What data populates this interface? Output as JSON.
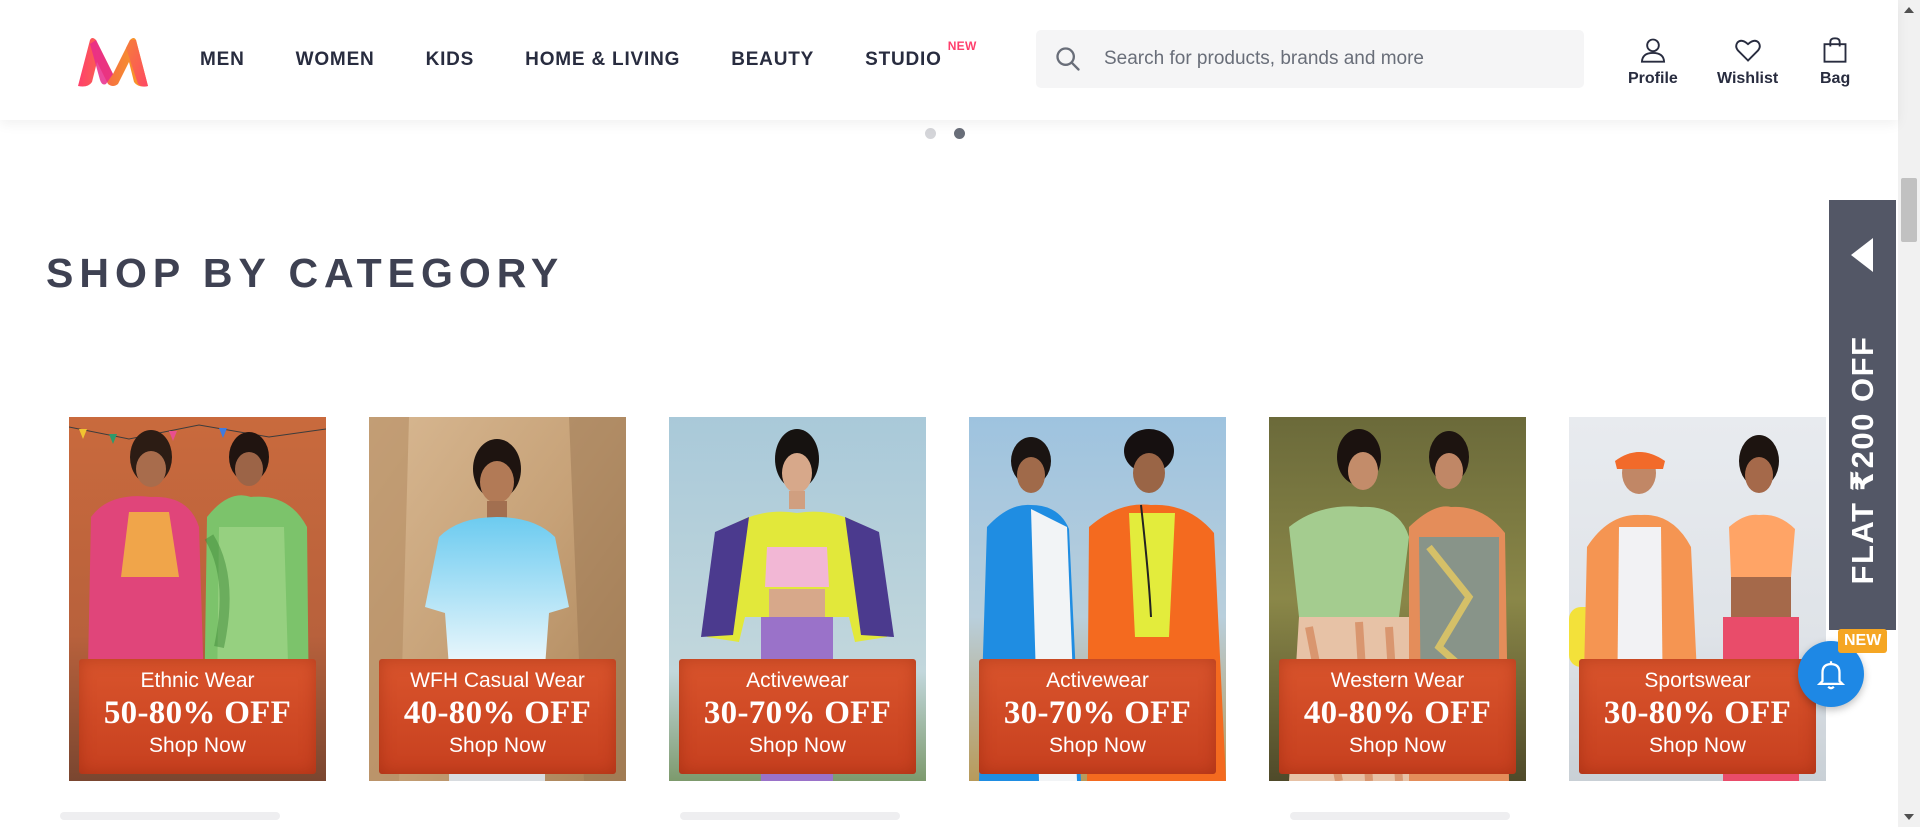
{
  "header": {
    "nav": [
      {
        "label": "MEN"
      },
      {
        "label": "WOMEN"
      },
      {
        "label": "KIDS"
      },
      {
        "label": "HOME & LIVING"
      },
      {
        "label": "BEAUTY"
      },
      {
        "label": "STUDIO",
        "tag": "NEW"
      }
    ],
    "search": {
      "placeholder": "Search for products, brands and more",
      "value": ""
    },
    "actions": {
      "profile": "Profile",
      "wishlist": "Wishlist",
      "bag": "Bag"
    }
  },
  "carousel": {
    "total_dots": 2,
    "active_dot": 2
  },
  "section_title": "SHOP BY CATEGORY",
  "categories": [
    {
      "name": "Ethnic Wear",
      "discount": "50-80% OFF",
      "cta": "Shop Now"
    },
    {
      "name": "WFH Casual Wear",
      "discount": "40-80% OFF",
      "cta": "Shop Now"
    },
    {
      "name": "Activewear",
      "discount": "30-70% OFF",
      "cta": "Shop Now"
    },
    {
      "name": "Activewear",
      "discount": "30-70% OFF",
      "cta": "Shop Now"
    },
    {
      "name": "Western Wear",
      "discount": "40-80% OFF",
      "cta": "Shop Now"
    },
    {
      "name": "Sportswear",
      "discount": "30-80% OFF",
      "cta": "Shop Now"
    }
  ],
  "side_banner": {
    "text": "FLAT ₹200 OFF",
    "badge": "NEW"
  },
  "colors": {
    "brand_pink": "#ff3f6c",
    "title_text": "#3e4152",
    "banner_bg": "#535766",
    "label_box": "#d24a27",
    "notify_blue": "#1e88e5",
    "new_badge": "#f5a623"
  },
  "icons": [
    "myntra-logo",
    "search-icon",
    "profile-icon",
    "wishlist-icon",
    "bag-icon",
    "bell-icon",
    "arrow-left-icon"
  ]
}
